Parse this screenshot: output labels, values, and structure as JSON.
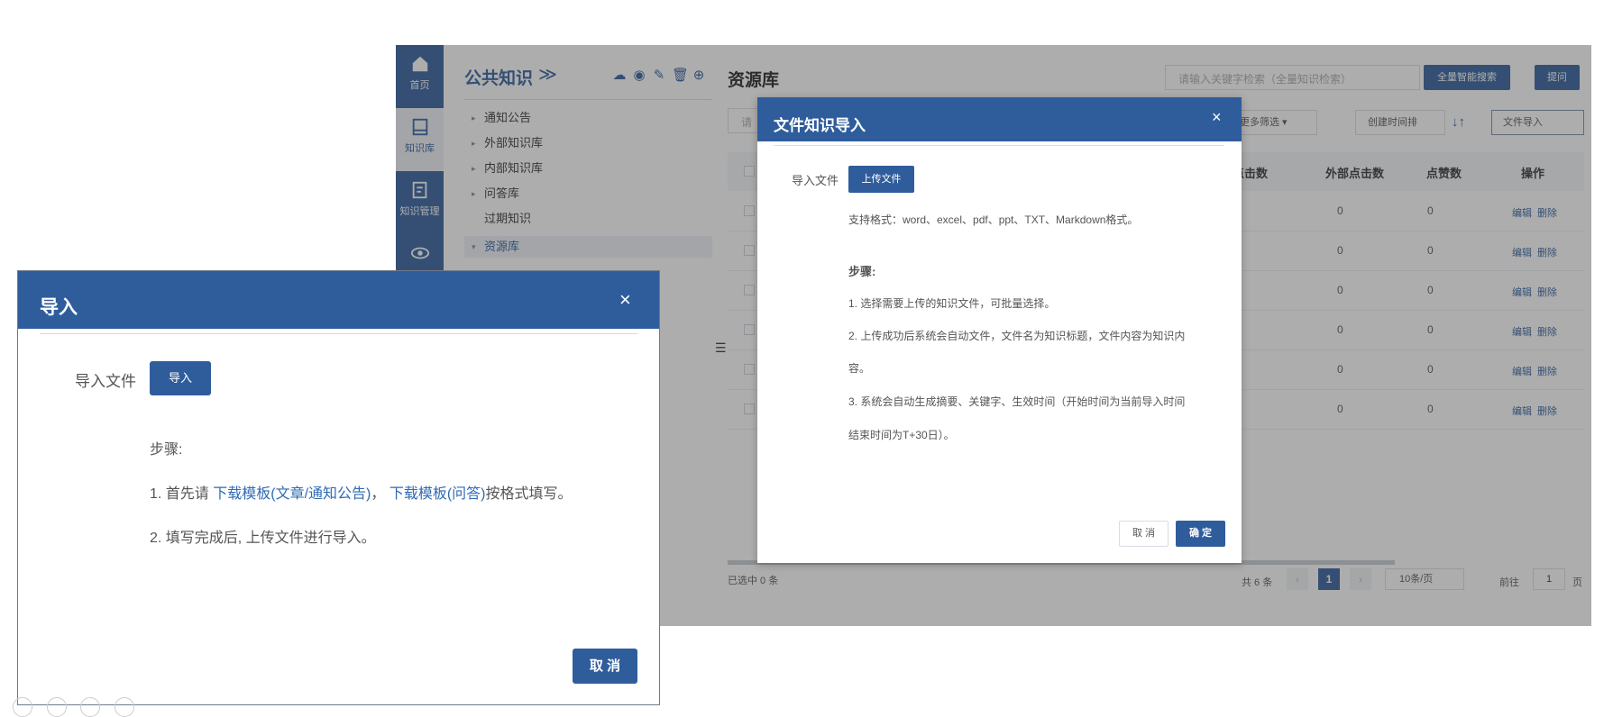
{
  "rail": {
    "items": [
      {
        "label": "首页",
        "icon": "home-icon"
      },
      {
        "label": "知识库",
        "icon": "book-icon"
      },
      {
        "label": "知识管理",
        "icon": "edit-doc-icon"
      },
      {
        "label": "",
        "icon": "eye-icon"
      }
    ]
  },
  "sidebar": {
    "title": "公共知识",
    "expand_glyph": "≫",
    "tree": [
      {
        "label": "通知公告",
        "arrow": "▸"
      },
      {
        "label": "外部知识库",
        "arrow": "▸"
      },
      {
        "label": "内部知识库",
        "arrow": "▸"
      },
      {
        "label": "问答库",
        "arrow": "▸"
      },
      {
        "label": "过期知识",
        "arrow": ""
      },
      {
        "label": "资源库",
        "arrow": "▾"
      }
    ]
  },
  "main": {
    "title": "资源库",
    "search_placeholder": "请输入关键字检索（全量知识检索）",
    "smart_search_label": "全量智能搜索",
    "ask_label": "提问",
    "filter_placeholder": "请",
    "more_filter_label": "更多筛选 ▾",
    "sort_label": "创建时间排",
    "import_label": "文件导入",
    "table": {
      "headers": [
        "点击数",
        "外部点击数",
        "点赞数",
        "操作"
      ],
      "rows": [
        {
          "ext_clicks": "0",
          "likes": "0",
          "edit": "编辑",
          "delete": "删除"
        },
        {
          "ext_clicks": "0",
          "likes": "0",
          "edit": "编辑",
          "delete": "删除"
        },
        {
          "ext_clicks": "0",
          "likes": "0",
          "edit": "编辑",
          "delete": "删除"
        },
        {
          "ext_clicks": "0",
          "likes": "0",
          "edit": "编辑",
          "delete": "删除"
        },
        {
          "ext_clicks": "0",
          "likes": "0",
          "edit": "编辑",
          "delete": "删除"
        },
        {
          "ext_clicks": "0",
          "likes": "0",
          "edit": "编辑",
          "delete": "删除"
        }
      ]
    },
    "selected_count": "已选中 0 条",
    "pagination": {
      "total": "共 6 条",
      "prev": "‹",
      "current": "1",
      "next": "›",
      "page_size": "10条/页",
      "goto_label": "前往",
      "goto_value": "1",
      "page_unit": "页"
    }
  },
  "modal_file_import": {
    "title": "文件知识导入",
    "close": "×",
    "field_label": "导入文件",
    "upload_label": "上传文件",
    "formats": "支持格式：word、excel、pdf、ppt、TXT、Markdown格式。",
    "steps_title": "步骤:",
    "step1": "1. 选择需要上传的知识文件，可批量选择。",
    "step2a": "2. 上传成功后系统会自动文件，文件名为知识标题，文件内容为知识内",
    "step2b": "容。",
    "step3a": "3. 系统会自动生成摘要、关键字、生效时间（开始时间为当前导入时间",
    "step3b": "结束时间为T+30日）。",
    "cancel_label": "取 消",
    "ok_label": "确 定"
  },
  "modal_import": {
    "title": "导入",
    "close": "×",
    "field_label": "导入文件",
    "import_label": "导入",
    "steps_title": "步骤:",
    "step1_prefix": "1. 首先请 ",
    "template_article_link": "下载模板(文章/通知公告)",
    "step1_sep": "， ",
    "template_qa_link": "下载模板(问答)",
    "step1_suffix": "按格式填写。",
    "step2": "2. 填写完成后, 上传文件进行导入。",
    "cancel_label": "取 消"
  },
  "colors": {
    "primary": "#2f5d9c",
    "link": "#2f6ab3",
    "overlay": "rgba(60,60,60,0.42)"
  }
}
